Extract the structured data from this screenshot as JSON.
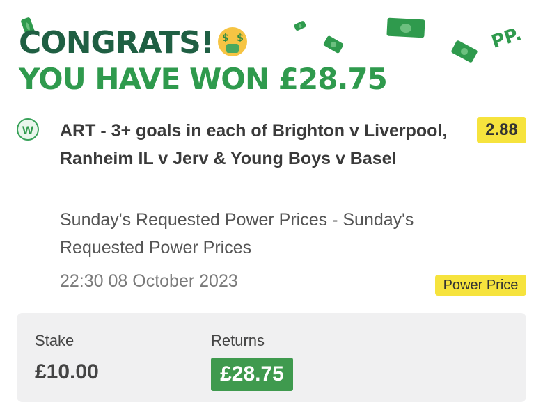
{
  "header": {
    "congrats": "CONGRATS!",
    "emoji_icon": "money-mouth-face-emoji",
    "win_prefix": "YOU HAVE WON ",
    "win_amount": "£28.75",
    "brand_logo_text": "PP."
  },
  "bet": {
    "status_letter": "W",
    "selection": "ART - 3+ goals in each of Brighton v Liverpool, Ranheim IL v Jerv & Young Boys v Basel",
    "odds": "2.88",
    "market": "Sunday's Requested Power Prices - Sunday's Requested Power Prices",
    "datetime": "22:30 08 October 2023",
    "badge": "Power Price"
  },
  "summary": {
    "stake_label": "Stake",
    "stake_value": "£10.00",
    "returns_label": "Returns",
    "returns_value": "£28.75"
  },
  "colors": {
    "dark_green": "#1f5f43",
    "brand_green": "#2f9a4d",
    "yellow_badge": "#f6e33d",
    "returns_green": "#3f9a4e",
    "panel_grey": "#f0f0f1"
  }
}
